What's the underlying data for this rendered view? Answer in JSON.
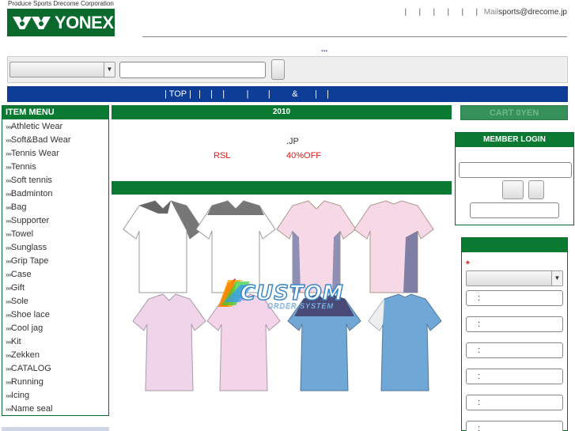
{
  "header": {
    "tagline": "Produce Sports Drecome Corporation",
    "logo_text": "YONEX",
    "top_links": [
      "|",
      "|",
      "|",
      "|",
      "|",
      "|"
    ],
    "mail_label": "Mail",
    "mail_address": "sports@drecome.jp",
    "dots": "..."
  },
  "search": {
    "category_value": "",
    "input_value": "",
    "button_label": ""
  },
  "nav": {
    "items": [
      "|",
      " TOP ",
      "|",
      "   |",
      "    |",
      "    |",
      "         |",
      "        |",
      "         &",
      "       |",
      "    |"
    ]
  },
  "sidebar": {
    "heading": "ITEM MENU",
    "bullet": "»",
    "items": [
      "Athletic Wear",
      "Soft&Bad Wear",
      "Tennis Wear",
      "Tennis",
      "Soft tennis",
      "Badminton",
      "Bag",
      "Supporter",
      "Towel",
      "Sunglass",
      "Grip Tape",
      "Case",
      "Gift",
      "Sole",
      "Shoe lace",
      "Cool jag",
      "Kit",
      "Zekken",
      "CATALOG",
      "Running",
      "Icing",
      "Name seal"
    ]
  },
  "main": {
    "heading": "2010",
    "jp_text": ".JP",
    "rsl_text": "RSL",
    "discount_text": "40%OFF",
    "banner_logo": "CUSTOM",
    "banner_sub": "ORDER SYSTEM"
  },
  "cart": {
    "label": "CART 0YEN"
  },
  "login": {
    "heading": "MEMBER LOGIN"
  },
  "custom_order": {
    "required_mark": "*",
    "colon": ":",
    "field_count": 6
  },
  "colors": {
    "green": "#0a7a32",
    "navy": "#0d3d96",
    "red": "#e01a1a"
  }
}
